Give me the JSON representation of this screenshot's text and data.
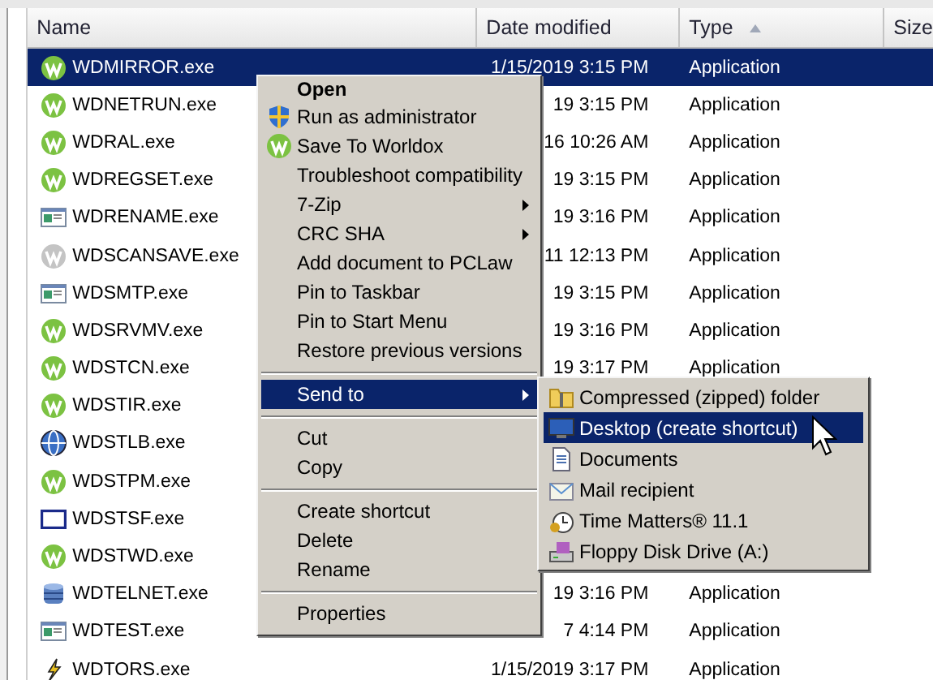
{
  "columns": [
    {
      "label": "Name",
      "sorted": false
    },
    {
      "label": "Date modified",
      "sorted": false
    },
    {
      "label": "Type",
      "sorted": true
    },
    {
      "label": "Size",
      "sorted": false
    }
  ],
  "files": [
    {
      "name": "WDMIRROR.exe",
      "kind": "worldox",
      "date": "1/15/2019 3:15 PM",
      "type": "Application",
      "selected": true
    },
    {
      "name": "WDNETRUN.exe",
      "kind": "worldox",
      "date": "19 3:15 PM",
      "type": "Application",
      "selected": false
    },
    {
      "name": "WDRAL.exe",
      "kind": "worldox",
      "date": "16 10:26 AM",
      "type": "Application",
      "selected": false
    },
    {
      "name": "WDREGSET.exe",
      "kind": "worldox",
      "date": "19 3:15 PM",
      "type": "Application",
      "selected": false
    },
    {
      "name": "WDRENAME.exe",
      "kind": "window",
      "date": "19 3:16 PM",
      "type": "Application",
      "selected": false
    },
    {
      "name": "WDSCANSAVE.exe",
      "kind": "disabled",
      "date": "11 12:13 PM",
      "type": "Application",
      "selected": false
    },
    {
      "name": "WDSMTP.exe",
      "kind": "window",
      "date": "19 3:15 PM",
      "type": "Application",
      "selected": false
    },
    {
      "name": "WDSRVMV.exe",
      "kind": "worldox",
      "date": "19 3:16 PM",
      "type": "Application",
      "selected": false
    },
    {
      "name": "WDSTCN.exe",
      "kind": "worldox",
      "date": "19 3:17 PM",
      "type": "Application",
      "selected": false
    },
    {
      "name": "WDSTIR.exe",
      "kind": "worldox",
      "selected": false
    },
    {
      "name": "WDSTLB.exe",
      "kind": "globe",
      "selected": false
    },
    {
      "name": "WDSTPM.exe",
      "kind": "worldox",
      "selected": false
    },
    {
      "name": "WDSTSF.exe",
      "kind": "frame",
      "selected": false
    },
    {
      "name": "WDSTWD.exe",
      "kind": "worldox",
      "selected": false
    },
    {
      "name": "WDTELNET.exe",
      "kind": "database",
      "date": "19 3:16 PM",
      "type": "Application",
      "selected": false
    },
    {
      "name": "WDTEST.exe",
      "kind": "window",
      "date": "7 4:14 PM",
      "type": "Application",
      "selected": false
    },
    {
      "name": "WDTORS.exe",
      "kind": "bolt",
      "date": "1/15/2019 3:17 PM",
      "type": "Application",
      "selected": false
    }
  ],
  "context_menu": {
    "items": [
      {
        "kind": "item",
        "label": "Open",
        "bold": true,
        "submenu": false,
        "selected": false
      },
      {
        "kind": "shield",
        "label": "Run as administrator",
        "bold": false,
        "submenu": false,
        "selected": false
      },
      {
        "kind": "worldox",
        "label": "Save To Worldox",
        "bold": false,
        "submenu": false,
        "selected": false
      },
      {
        "kind": "item",
        "label": "Troubleshoot compatibility",
        "bold": false,
        "submenu": false,
        "selected": false
      },
      {
        "kind": "item",
        "label": "7-Zip",
        "bold": false,
        "submenu": true,
        "selected": false
      },
      {
        "kind": "item",
        "label": "CRC SHA",
        "bold": false,
        "submenu": true,
        "selected": false
      },
      {
        "kind": "item",
        "label": "Add document to PCLaw",
        "bold": false,
        "submenu": false,
        "selected": false
      },
      {
        "kind": "item",
        "label": "Pin to Taskbar",
        "bold": false,
        "submenu": false,
        "selected": false
      },
      {
        "kind": "item",
        "label": "Pin to Start Menu",
        "bold": false,
        "submenu": false,
        "selected": false
      },
      {
        "kind": "item",
        "label": "Restore previous versions",
        "bold": false,
        "submenu": false,
        "selected": false
      },
      {
        "kind": "separator"
      },
      {
        "kind": "item",
        "label": "Send to",
        "bold": false,
        "submenu": true,
        "selected": true
      },
      {
        "kind": "separator"
      },
      {
        "kind": "item",
        "label": "Cut",
        "bold": false,
        "submenu": false,
        "selected": false
      },
      {
        "kind": "item",
        "label": "Copy",
        "bold": false,
        "submenu": false,
        "selected": false
      },
      {
        "kind": "separator"
      },
      {
        "kind": "item",
        "label": "Create shortcut",
        "bold": false,
        "submenu": false,
        "selected": false
      },
      {
        "kind": "item",
        "label": "Delete",
        "bold": false,
        "submenu": false,
        "selected": false
      },
      {
        "kind": "item",
        "label": "Rename",
        "bold": false,
        "submenu": false,
        "selected": false
      },
      {
        "kind": "separator"
      },
      {
        "kind": "item",
        "label": "Properties",
        "bold": false,
        "submenu": false,
        "selected": false
      }
    ]
  },
  "send_to_menu": {
    "items": [
      {
        "label": "Compressed (zipped) folder",
        "kind": "zip",
        "selected": false
      },
      {
        "label": "Desktop (create shortcut)",
        "kind": "desktop",
        "selected": true
      },
      {
        "label": "Documents",
        "kind": "document",
        "selected": false
      },
      {
        "label": "Mail recipient",
        "kind": "mail",
        "selected": false
      },
      {
        "label": "Time Matters® 11.1",
        "kind": "clock",
        "selected": false
      },
      {
        "label": "Floppy Disk Drive (A:)",
        "kind": "floppy",
        "selected": false
      }
    ]
  }
}
